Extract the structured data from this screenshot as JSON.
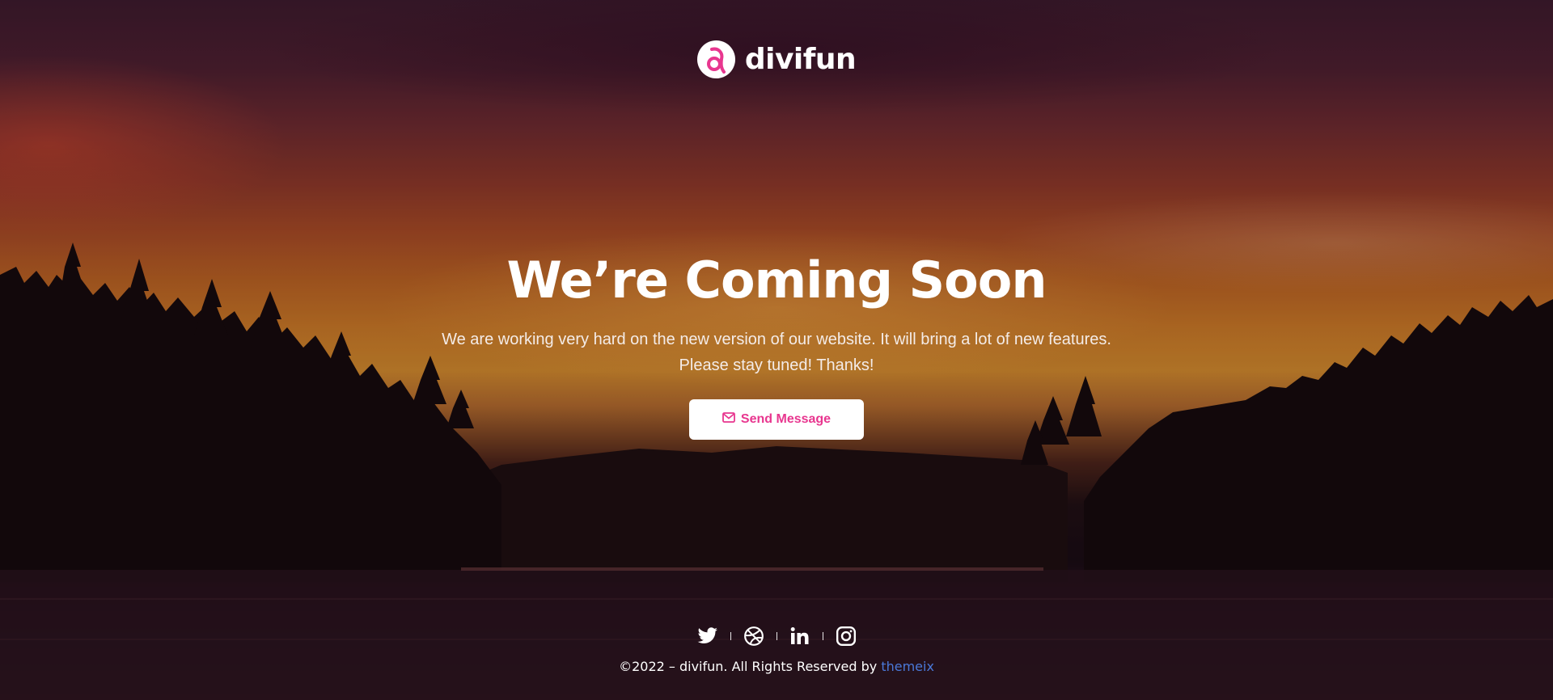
{
  "brand": {
    "name": "divifun",
    "logo_icon": "divifun-logo-icon",
    "accent_color": "#e8368f"
  },
  "hero": {
    "title": "We’re Coming Soon",
    "description_line1": "We are working very hard on the new version of our website. It will bring a  lot of new features.",
    "description_line2": "Please stay tuned! Thanks!",
    "button_label": "Send Message",
    "button_icon": "envelope-icon"
  },
  "social": [
    {
      "name": "twitter",
      "icon": "twitter-icon"
    },
    {
      "name": "dribbble",
      "icon": "dribbble-icon"
    },
    {
      "name": "linkedin",
      "icon": "linkedin-icon"
    },
    {
      "name": "instagram",
      "icon": "instagram-icon"
    }
  ],
  "footer": {
    "copyright": "©2022 – divifun. All Rights Reserved by ",
    "link_text": "themeix",
    "link_color": "#4a78d8"
  }
}
